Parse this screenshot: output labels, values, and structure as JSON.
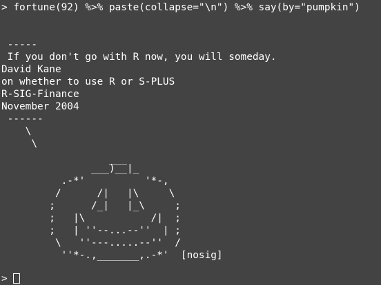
{
  "terminal": {
    "background": "#434343",
    "foreground": "#ffffff",
    "command": "> fortune(92) %>% paste(collapse=\"\\n\") %>% say(by=\"pumpkin\")",
    "output_lines": [
      "",
      " -----",
      " If you don't go with R now, you will someday.",
      "David Kane",
      "on whether to use R or S-PLUS",
      "R-SIG-Finance",
      "November 2004",
      " ------",
      "    \\",
      "     \\",
      "",
      "                  ___",
      "               ___)__|_",
      "          .-*'          '*-,",
      "         /      /|   |\\     \\",
      "        ;      /_|   |_\\     ;",
      "        ;   |\\           /|  ;",
      "        ;   | ''--...--''  | ;",
      "         \\   ''---.....--''  /",
      "          ''*-.,_______,.-*'  [nosig]",
      ""
    ],
    "prompt": "> "
  }
}
